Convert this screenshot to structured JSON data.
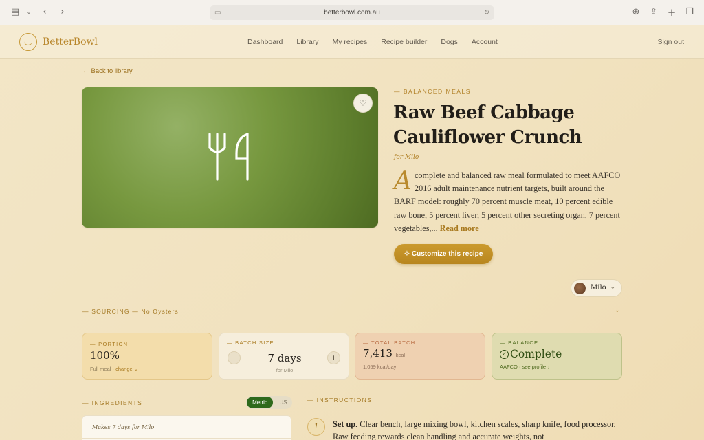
{
  "browser": {
    "url": "betterbowl.com.au"
  },
  "nav": {
    "brand": "BetterBowl",
    "links": [
      "Dashboard",
      "Library",
      "My recipes",
      "Recipe builder",
      "Dogs",
      "Account"
    ],
    "signout": "Sign out"
  },
  "back_label": "Back to library",
  "recipe": {
    "kicker": "— BALANCED MEALS",
    "title": "Raw Beef Cabbage Cauliflower Crunch",
    "for": "for Milo",
    "drop_cap": "A",
    "description": "complete and balanced raw meal formulated to meet AAFCO 2016 adult maintenance nutrient targets, built around the BARF model: roughly 70 percent muscle meat, 10 percent edible raw bone, 5 percent liver, 5 percent other secreting organ, 7 percent vegetables,...",
    "read_more": "Read more",
    "customize": "Customize this recipe"
  },
  "dog_selector": {
    "name": "Milo"
  },
  "sourcing": "— SOURCING — No Oysters",
  "stats": {
    "portion": {
      "label": "— PORTION",
      "value": "100%",
      "sub": "Full meal · ",
      "link": "change ⌄"
    },
    "batch": {
      "label": "— BATCH SIZE",
      "value": "7 days",
      "sub": "for Milo",
      "minus": "−",
      "plus": "+"
    },
    "total": {
      "label": "— TOTAL BATCH",
      "value": "7,413",
      "unit": "kcal",
      "sub": "1,059 kcal/day"
    },
    "balance": {
      "label": "— BALANCE",
      "value": "Complete",
      "sub": "AAFCO · see profile ↓"
    }
  },
  "ingredients": {
    "heading": "— INGREDIENTS",
    "units": [
      "Metric",
      "US"
    ],
    "makes": "Makes 7 days for Milo"
  },
  "instructions": {
    "heading": "— INSTRUCTIONS",
    "step_number": "1",
    "step_title": "Set up.",
    "step_text": " Clear bench, large mixing bowl, kitchen scales, sharp knife, food processor. Raw feeding rewards clean handling and accurate weights, not"
  },
  "colors": {
    "accent": "#b8862b",
    "success": "#2e6a1c",
    "background": "#f3e6c7"
  }
}
